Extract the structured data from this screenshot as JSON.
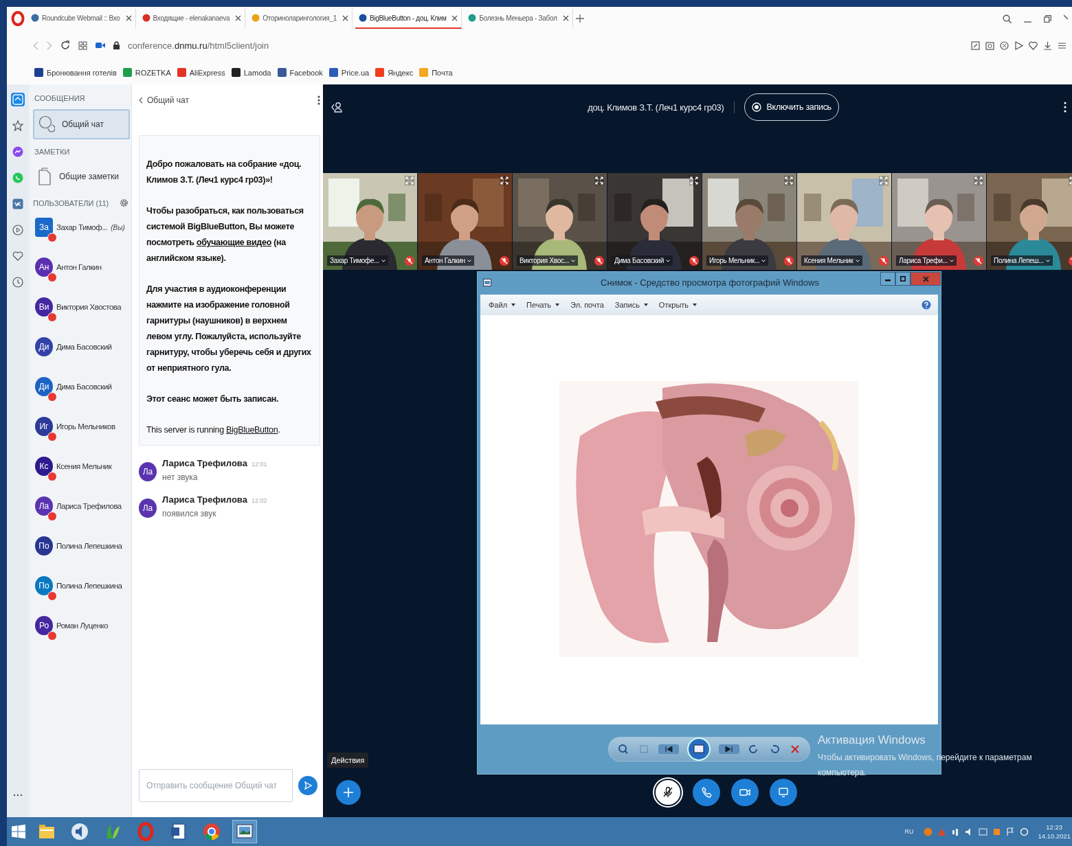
{
  "browser": {
    "tabs": [
      {
        "title": "Roundcube Webmail :: Вхо",
        "color": "#3a6ea5",
        "selected": false
      },
      {
        "title": "Входящие - elenakanaeva",
        "color": "#d93025",
        "selected": false
      },
      {
        "title": "Оториноларингология_1",
        "color": "#e8a317",
        "selected": false
      },
      {
        "title": "BigBlueButton - доц. Клим",
        "color": "#1a4f9c",
        "selected": true
      },
      {
        "title": "Болезнь Меньера - Забол",
        "color": "#1f9e8a",
        "selected": false
      }
    ],
    "address": "conference.**dnmu.ru**/html5client/join",
    "bookmarks": [
      {
        "label": "Бронювання готелів",
        "color": "#1c3f94"
      },
      {
        "label": "ROZETKA",
        "color": "#1e9e4a"
      },
      {
        "label": "AliExpress",
        "color": "#e43225"
      },
      {
        "label": "Lamoda",
        "color": "#222222"
      },
      {
        "label": "Facebook",
        "color": "#3b5998"
      },
      {
        "label": "Price.ua",
        "color": "#2b5eb8"
      },
      {
        "label": "Яндекс",
        "color": "#f33d1f"
      },
      {
        "label": "Почта",
        "color": "#f5a623"
      }
    ]
  },
  "opera_sidebar": {
    "items": [
      {
        "kind": "home",
        "selected": true
      },
      {
        "kind": "star",
        "selected": false
      },
      {
        "kind": "messenger",
        "selected": false
      },
      {
        "kind": "whatsapp",
        "selected": false
      },
      {
        "kind": "vk",
        "selected": false
      },
      {
        "kind": "player",
        "selected": false
      },
      {
        "kind": "heart",
        "selected": false
      },
      {
        "kind": "history",
        "selected": false
      },
      {
        "kind": "more",
        "selected": false
      }
    ]
  },
  "user_panel": {
    "messages_heading": "СООБЩЕНИЯ",
    "chats": [
      {
        "label": "Общий чат",
        "selected": true
      }
    ],
    "notes_heading": "ЗАМЕТКИ",
    "notes": [
      {
        "label": "Общие заметки"
      }
    ],
    "users_heading": "ПОЛЬЗОВАТЕЛИ (11)",
    "users": [
      {
        "initials": "За",
        "name": "Захар Тимоф...",
        "suffix": "(Вы)",
        "color": "#1b6ac9",
        "moderator": true,
        "muted": true
      },
      {
        "initials": "Ан",
        "name": "Антон Галкин",
        "color": "#5b2fb0",
        "moderator": false,
        "muted": true
      },
      {
        "initials": "Ви",
        "name": "Виктория Хвостова",
        "color": "#4527a0",
        "moderator": false,
        "muted": true
      },
      {
        "initials": "Ди",
        "name": "Дима Басовский",
        "color": "#3342a8",
        "moderator": false,
        "muted": false
      },
      {
        "initials": "Ди",
        "name": "Дима Басовский",
        "color": "#1d62c5",
        "moderator": false,
        "muted": true
      },
      {
        "initials": "Иг",
        "name": "Игорь Мельников",
        "color": "#2c3a9a",
        "moderator": false,
        "muted": true
      },
      {
        "initials": "Кс",
        "name": "Ксения Мельник",
        "color": "#2e1a8e",
        "moderator": false,
        "muted": true
      },
      {
        "initials": "Ла",
        "name": "Лариса Трефилова",
        "color": "#5a34b0",
        "moderator": false,
        "muted": true
      },
      {
        "initials": "По",
        "name": "Полина Лепешкина",
        "color": "#283593",
        "moderator": false,
        "muted": false
      },
      {
        "initials": "По",
        "name": "Полина Лепешкина",
        "color": "#0a78c0",
        "moderator": false,
        "muted": true
      },
      {
        "initials": "Ро",
        "name": "Роман Луценко",
        "color": "#4527a0",
        "moderator": false,
        "muted": true
      }
    ]
  },
  "chat": {
    "title": "Общий чат",
    "welcome": [
      {
        "bold": true,
        "parts": [
          {
            "kind": "text",
            "text": "Добро пожаловать на собрание «**доц. Климов З.Т. (Леч1 курс4 гр03)**»!"
          }
        ]
      },
      {
        "bold": true,
        "parts": [
          {
            "kind": "text",
            "text": "Чтобы разобраться, как пользоваться системой BigBlueButton, Вы можете посмотреть "
          },
          {
            "kind": "link",
            "text": "обучающие видео"
          },
          {
            "kind": "text",
            "text": " (на английском языке)."
          }
        ]
      },
      {
        "bold": true,
        "parts": [
          {
            "kind": "text",
            "text": "Для участия в аудиоконференции нажмите на изображение головной гарнитуры (наушников) в верхнем левом углу. **Пожалуйста, используйте гарнитуру, чтобы уберечь себя и других от неприятного гула.**"
          }
        ]
      },
      {
        "bold": true,
        "parts": [
          {
            "kind": "text",
            "text": "Этот сеанс может быть записан."
          }
        ]
      },
      {
        "bold": false,
        "parts": [
          {
            "kind": "text",
            "text": "This server is running "
          },
          {
            "kind": "link",
            "text": "BigBlueButton"
          },
          {
            "kind": "text",
            "text": "."
          }
        ]
      }
    ],
    "messages": [
      {
        "initials": "Ла",
        "author": "Лариса Трефилова",
        "time": "12:01",
        "text": "нет звука",
        "color": "#5a34b0"
      },
      {
        "initials": "Ла",
        "author": "Лариса Трефилова",
        "time": "12:02",
        "text": "появился звук",
        "color": "#5a34b0"
      }
    ],
    "input": {
      "placeholder": "Отправить сообщение Общий чат"
    }
  },
  "meeting": {
    "title": "доц. Климов З.Т. (Леч1 курс4 гр03)",
    "record_button": "Включить запись",
    "videos": [
      {
        "name": "Захар Тимофе...",
        "muted": true
      },
      {
        "name": "Антон Галкин",
        "muted": true
      },
      {
        "name": "Виктория Хвос...",
        "muted": true
      },
      {
        "name": "Дима Басовский",
        "muted": true
      },
      {
        "name": "Игорь Мельник...",
        "muted": true
      },
      {
        "name": "Ксения Мельник",
        "muted": true
      },
      {
        "name": "Лариса Трефи...",
        "muted": true
      },
      {
        "name": "Полина Лепеш...",
        "muted": true
      }
    ],
    "actions_tooltip": "Действия",
    "controls": [
      {
        "kind": "mic_off"
      },
      {
        "kind": "audio"
      },
      {
        "kind": "camera"
      },
      {
        "kind": "screen"
      }
    ]
  },
  "photo_viewer": {
    "title": "Снимок - Средство просмотра фотографий Windows",
    "menu": [
      {
        "label": "Файл",
        "dropdown": true
      },
      {
        "label": "Печать",
        "dropdown": true
      },
      {
        "label": "Эл. почта",
        "dropdown": false
      },
      {
        "label": "Запись",
        "dropdown": true
      },
      {
        "label": "Открыть",
        "dropdown": true
      }
    ]
  },
  "activation_notice": {
    "title": "Активация Windows",
    "text": "Чтобы активировать Windows, перейдите к параметрам компьютера."
  },
  "taskbar": {
    "apps": [
      {
        "kind": "explorer",
        "active": false
      },
      {
        "kind": "media",
        "active": false
      },
      {
        "kind": "leaf",
        "active": false
      },
      {
        "kind": "opera",
        "active": false
      },
      {
        "kind": "word",
        "active": false
      },
      {
        "kind": "chrome",
        "active": false
      },
      {
        "kind": "photos",
        "active": true
      }
    ],
    "language": "RU",
    "time": "12:23",
    "date": "14.10.2021"
  }
}
